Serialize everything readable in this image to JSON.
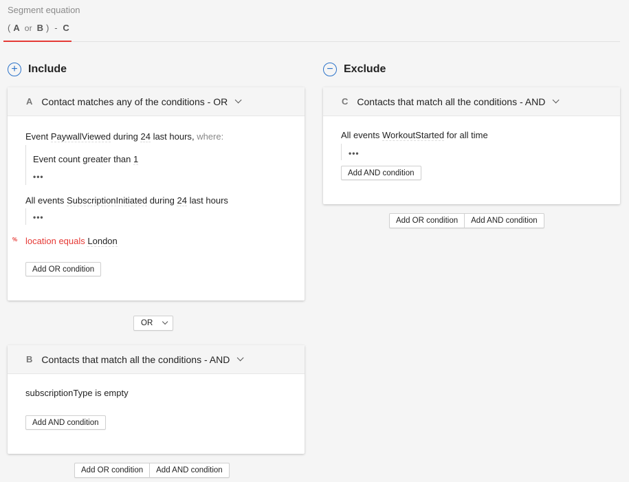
{
  "equation": {
    "label": "Segment equation",
    "open": "(",
    "a": "A",
    "or": "or",
    "b": "B",
    "close": ")",
    "minus": "-",
    "c": "C"
  },
  "include": {
    "icon": "plus-circle-icon",
    "icon_glyph": "+",
    "title": "Include"
  },
  "exclude": {
    "icon": "minus-circle-icon",
    "icon_glyph": "−",
    "title": "Exclude"
  },
  "groupA": {
    "letter": "A",
    "title": "Contact matches any of the conditions - OR",
    "cond1": {
      "prefix": "Event",
      "event": "PaywallViewed",
      "during": "during",
      "num": "24",
      "unit": "last hours",
      "comma": ",",
      "where": "where:"
    },
    "sub1": {
      "field": "Event count",
      "op": "greater than",
      "value": "1"
    },
    "dots": "•••",
    "cond2": {
      "prefix": "All events",
      "event": "SubscriptionInitiated",
      "during": "during",
      "num": "24",
      "unit": "last hours"
    },
    "cond3": {
      "issue": "%",
      "field": "location",
      "op": "equals",
      "value": "London"
    },
    "add_or": "Add OR condition"
  },
  "connector": {
    "value": "OR"
  },
  "groupB": {
    "letter": "B",
    "title": "Contacts that match all the conditions - AND",
    "cond1": {
      "field": "subscriptionType",
      "op": "is empty"
    },
    "add_and": "Add AND condition"
  },
  "groupC": {
    "letter": "C",
    "title": "Contacts that match all the conditions - AND",
    "cond1": {
      "prefix": "All events",
      "event": "WorkoutStarted",
      "period": "for all time"
    },
    "dots": "•••",
    "add_and": "Add AND condition"
  },
  "include_footer": {
    "add_or": "Add OR condition",
    "add_and": "Add AND condition"
  },
  "exclude_footer": {
    "add_or": "Add OR condition",
    "add_and": "Add AND condition"
  }
}
